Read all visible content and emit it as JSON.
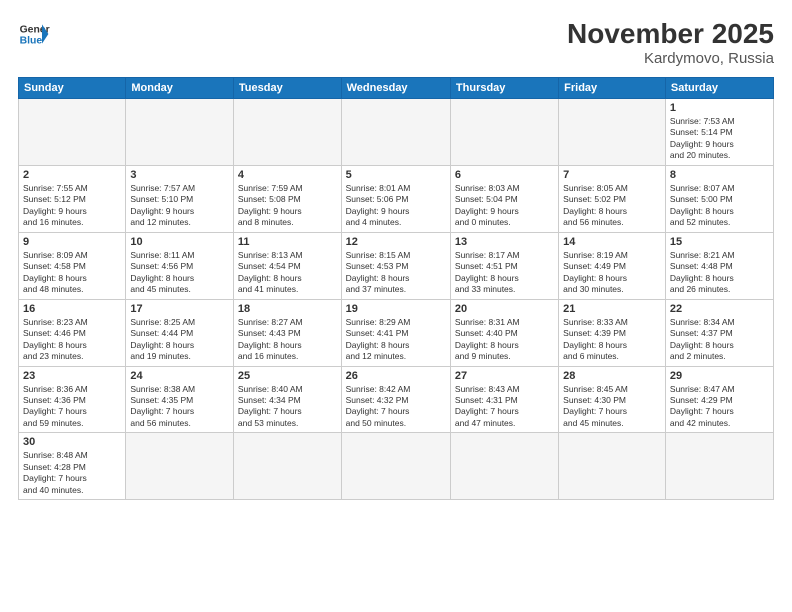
{
  "header": {
    "logo_general": "General",
    "logo_blue": "Blue",
    "month_year": "November 2025",
    "location": "Kardymovo, Russia"
  },
  "weekdays": [
    "Sunday",
    "Monday",
    "Tuesday",
    "Wednesday",
    "Thursday",
    "Friday",
    "Saturday"
  ],
  "weeks": [
    [
      {
        "day": "",
        "info": ""
      },
      {
        "day": "",
        "info": ""
      },
      {
        "day": "",
        "info": ""
      },
      {
        "day": "",
        "info": ""
      },
      {
        "day": "",
        "info": ""
      },
      {
        "day": "",
        "info": ""
      },
      {
        "day": "1",
        "info": "Sunrise: 7:53 AM\nSunset: 5:14 PM\nDaylight: 9 hours\nand 20 minutes."
      }
    ],
    [
      {
        "day": "2",
        "info": "Sunrise: 7:55 AM\nSunset: 5:12 PM\nDaylight: 9 hours\nand 16 minutes."
      },
      {
        "day": "3",
        "info": "Sunrise: 7:57 AM\nSunset: 5:10 PM\nDaylight: 9 hours\nand 12 minutes."
      },
      {
        "day": "4",
        "info": "Sunrise: 7:59 AM\nSunset: 5:08 PM\nDaylight: 9 hours\nand 8 minutes."
      },
      {
        "day": "5",
        "info": "Sunrise: 8:01 AM\nSunset: 5:06 PM\nDaylight: 9 hours\nand 4 minutes."
      },
      {
        "day": "6",
        "info": "Sunrise: 8:03 AM\nSunset: 5:04 PM\nDaylight: 9 hours\nand 0 minutes."
      },
      {
        "day": "7",
        "info": "Sunrise: 8:05 AM\nSunset: 5:02 PM\nDaylight: 8 hours\nand 56 minutes."
      },
      {
        "day": "8",
        "info": "Sunrise: 8:07 AM\nSunset: 5:00 PM\nDaylight: 8 hours\nand 52 minutes."
      }
    ],
    [
      {
        "day": "9",
        "info": "Sunrise: 8:09 AM\nSunset: 4:58 PM\nDaylight: 8 hours\nand 48 minutes."
      },
      {
        "day": "10",
        "info": "Sunrise: 8:11 AM\nSunset: 4:56 PM\nDaylight: 8 hours\nand 45 minutes."
      },
      {
        "day": "11",
        "info": "Sunrise: 8:13 AM\nSunset: 4:54 PM\nDaylight: 8 hours\nand 41 minutes."
      },
      {
        "day": "12",
        "info": "Sunrise: 8:15 AM\nSunset: 4:53 PM\nDaylight: 8 hours\nand 37 minutes."
      },
      {
        "day": "13",
        "info": "Sunrise: 8:17 AM\nSunset: 4:51 PM\nDaylight: 8 hours\nand 33 minutes."
      },
      {
        "day": "14",
        "info": "Sunrise: 8:19 AM\nSunset: 4:49 PM\nDaylight: 8 hours\nand 30 minutes."
      },
      {
        "day": "15",
        "info": "Sunrise: 8:21 AM\nSunset: 4:48 PM\nDaylight: 8 hours\nand 26 minutes."
      }
    ],
    [
      {
        "day": "16",
        "info": "Sunrise: 8:23 AM\nSunset: 4:46 PM\nDaylight: 8 hours\nand 23 minutes."
      },
      {
        "day": "17",
        "info": "Sunrise: 8:25 AM\nSunset: 4:44 PM\nDaylight: 8 hours\nand 19 minutes."
      },
      {
        "day": "18",
        "info": "Sunrise: 8:27 AM\nSunset: 4:43 PM\nDaylight: 8 hours\nand 16 minutes."
      },
      {
        "day": "19",
        "info": "Sunrise: 8:29 AM\nSunset: 4:41 PM\nDaylight: 8 hours\nand 12 minutes."
      },
      {
        "day": "20",
        "info": "Sunrise: 8:31 AM\nSunset: 4:40 PM\nDaylight: 8 hours\nand 9 minutes."
      },
      {
        "day": "21",
        "info": "Sunrise: 8:33 AM\nSunset: 4:39 PM\nDaylight: 8 hours\nand 6 minutes."
      },
      {
        "day": "22",
        "info": "Sunrise: 8:34 AM\nSunset: 4:37 PM\nDaylight: 8 hours\nand 2 minutes."
      }
    ],
    [
      {
        "day": "23",
        "info": "Sunrise: 8:36 AM\nSunset: 4:36 PM\nDaylight: 7 hours\nand 59 minutes."
      },
      {
        "day": "24",
        "info": "Sunrise: 8:38 AM\nSunset: 4:35 PM\nDaylight: 7 hours\nand 56 minutes."
      },
      {
        "day": "25",
        "info": "Sunrise: 8:40 AM\nSunset: 4:34 PM\nDaylight: 7 hours\nand 53 minutes."
      },
      {
        "day": "26",
        "info": "Sunrise: 8:42 AM\nSunset: 4:32 PM\nDaylight: 7 hours\nand 50 minutes."
      },
      {
        "day": "27",
        "info": "Sunrise: 8:43 AM\nSunset: 4:31 PM\nDaylight: 7 hours\nand 47 minutes."
      },
      {
        "day": "28",
        "info": "Sunrise: 8:45 AM\nSunset: 4:30 PM\nDaylight: 7 hours\nand 45 minutes."
      },
      {
        "day": "29",
        "info": "Sunrise: 8:47 AM\nSunset: 4:29 PM\nDaylight: 7 hours\nand 42 minutes."
      }
    ],
    [
      {
        "day": "30",
        "info": "Sunrise: 8:48 AM\nSunset: 4:28 PM\nDaylight: 7 hours\nand 40 minutes."
      },
      {
        "day": "",
        "info": ""
      },
      {
        "day": "",
        "info": ""
      },
      {
        "day": "",
        "info": ""
      },
      {
        "day": "",
        "info": ""
      },
      {
        "day": "",
        "info": ""
      },
      {
        "day": "",
        "info": ""
      }
    ]
  ]
}
